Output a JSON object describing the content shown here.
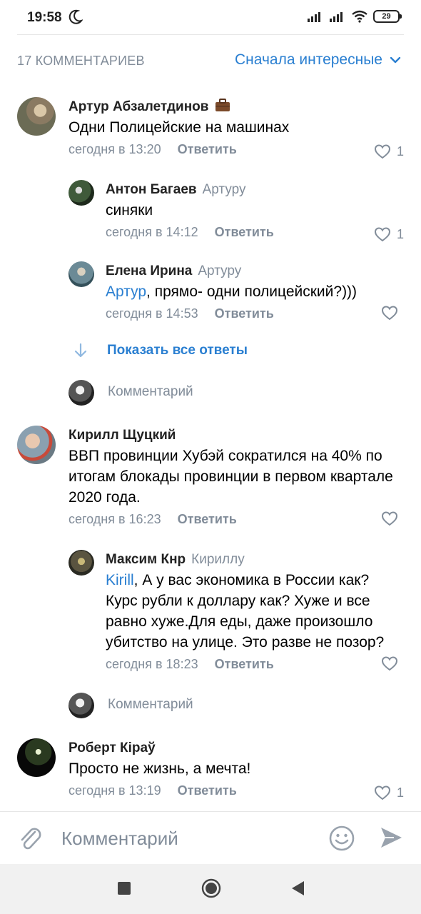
{
  "status_bar": {
    "time": "19:58",
    "battery": "29"
  },
  "header": {
    "count_label": "17 КОММЕНТАРИЕВ",
    "sort_label": "Сначала интересные"
  },
  "comments": [
    {
      "author": "Артур Абзалетдинов",
      "reply_to": "",
      "mention": "",
      "text": "Одни Полицейские на машинах",
      "time": "сегодня в 13:20",
      "reply_label": "Ответить",
      "likes": "1"
    },
    {
      "author": "Антон Багаев",
      "reply_to": "Артуру",
      "mention": "",
      "text": "синяки",
      "time": "сегодня в 14:12",
      "reply_label": "Ответить",
      "likes": "1"
    },
    {
      "author": "Елена Ирина",
      "reply_to": "Артуру",
      "mention": "Артур",
      "text": ", прямо- одни полицейский?)))",
      "time": "сегодня в 14:53",
      "reply_label": "Ответить",
      "likes": ""
    },
    {
      "author": "Кирилл Щуцкий",
      "reply_to": "",
      "mention": "",
      "text": "ВВП провинции Хубэй сократился на 40% по итогам блокады провинции в первом квартале 2020 года.",
      "time": "сегодня в 16:23",
      "reply_label": "Ответить",
      "likes": ""
    },
    {
      "author": "Максим Кнр",
      "reply_to": "Кириллу",
      "mention": "Kirill",
      "text": ", А у вас экономика в России как? Курс рубли к доллару как? Хуже и все равно хуже.Для еды, даже произошло убитство на улице. Это разве не позор?",
      "time": "сегодня в 18:23",
      "reply_label": "Ответить",
      "likes": ""
    },
    {
      "author": "Роберт Кіраў",
      "reply_to": "",
      "mention": "",
      "text": "Просто не жизнь, а мечта!",
      "time": "сегодня в 13:19",
      "reply_label": "Ответить",
      "likes": "1"
    }
  ],
  "show_all_replies": "Показать все ответы",
  "inline_comment_placeholder": "Комментарий",
  "composer": {
    "placeholder": "Комментарий"
  },
  "colors": {
    "accent": "#2a7fd1",
    "secondary_text": "#818c99",
    "nav_bg": "#f1f1f1"
  },
  "icons": [
    "moon-icon",
    "signal-icon",
    "wifi-icon",
    "battery-icon",
    "chevron-down-icon",
    "briefcase-icon",
    "heart-icon",
    "arrow-down-icon",
    "paperclip-icon",
    "smile-icon",
    "send-icon",
    "nav-square-icon",
    "nav-circle-icon",
    "nav-back-icon"
  ]
}
